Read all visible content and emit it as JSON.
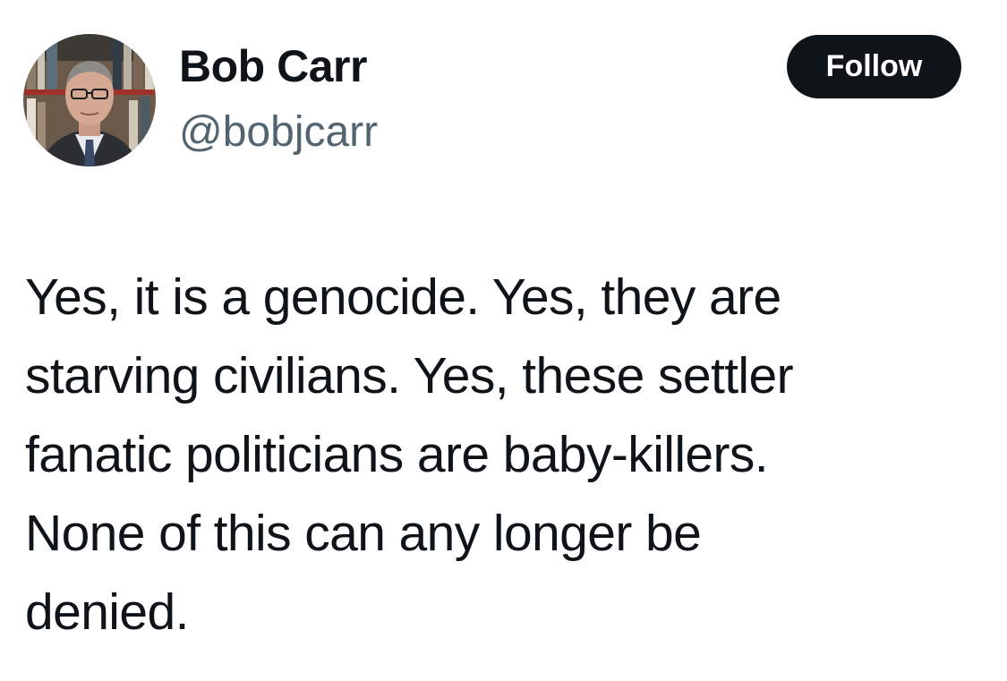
{
  "author": {
    "display_name": "Bob Carr",
    "handle": "@bobjcarr",
    "avatar_icon": "profile-photo"
  },
  "follow_button": {
    "label": "Follow",
    "background": "#0f1419",
    "text_color": "#ffffff"
  },
  "tweet": {
    "lines": [
      "Yes, it is a genocide. Yes, they are",
      "starving civilians. Yes, these settler",
      "fanatic politicians are baby-killers.",
      "None of this can any longer be",
      "denied."
    ]
  },
  "colors": {
    "text_primary": "#0f1419",
    "text_secondary": "#536471",
    "background": "#ffffff"
  }
}
